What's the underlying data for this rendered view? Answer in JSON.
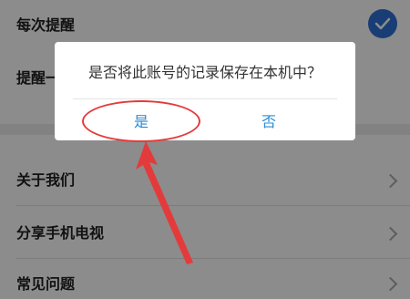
{
  "settings": {
    "items": [
      {
        "label": "每次提醒"
      },
      {
        "label": "提醒一"
      },
      {
        "label": "关于我们"
      },
      {
        "label": "分享手机电视"
      },
      {
        "label": "常见问题"
      }
    ],
    "checkbox_state": "checked"
  },
  "dialog": {
    "message": "是否将此账号的记录保存在本机中？",
    "yes_label": "是",
    "no_label": "否"
  },
  "colors": {
    "accent": "#2f6fd6",
    "dialog_button": "#2a8bd4",
    "annotation": "#e33b3b"
  }
}
